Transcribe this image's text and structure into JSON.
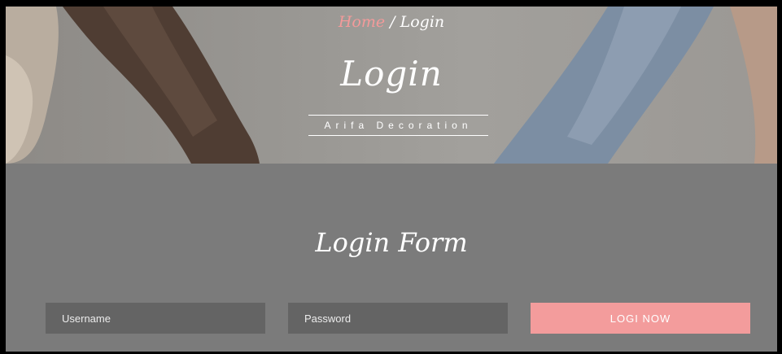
{
  "breadcrumb": {
    "home": "Home",
    "separator": " / ",
    "current": "Login"
  },
  "hero": {
    "title": "Login",
    "subtitle": "Arifa Decoration"
  },
  "form": {
    "title": "Login Form",
    "username_placeholder": "Username",
    "password_placeholder": "Password",
    "submit_label": "LOGI NOW"
  },
  "colors": {
    "accent": "#f39c9c",
    "section_bg": "#7b7b7b",
    "input_bg": "#646464"
  }
}
